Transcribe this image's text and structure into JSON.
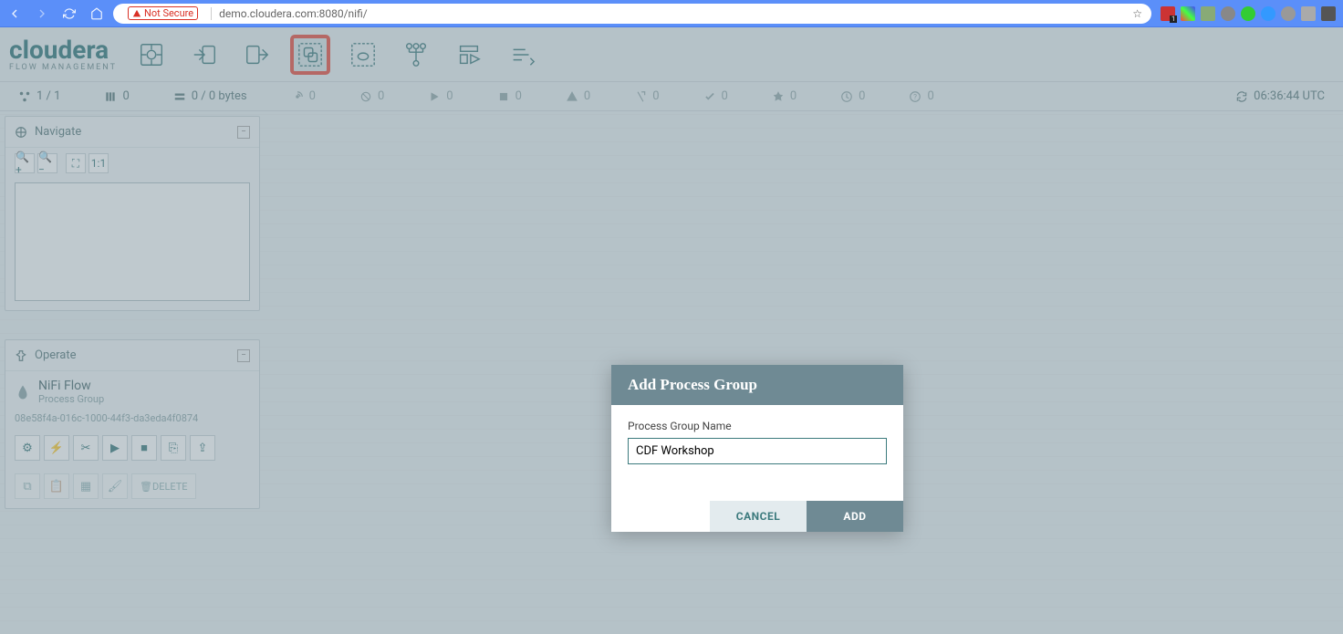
{
  "browser": {
    "not_secure": "Not Secure",
    "url": "demo.cloudera.com:8080/nifi/",
    "ext_badge": "1"
  },
  "logo": {
    "brand": "cloudera",
    "sub": "FLOW MANAGEMENT"
  },
  "toolbar": {
    "items": [
      {
        "name": "processor"
      },
      {
        "name": "input-port"
      },
      {
        "name": "output-port"
      },
      {
        "name": "process-group",
        "highlight": true
      },
      {
        "name": "remote-process-group"
      },
      {
        "name": "funnel"
      },
      {
        "name": "template"
      },
      {
        "name": "label"
      }
    ]
  },
  "status": {
    "nodes": "1 / 1",
    "threads": "0",
    "queued": "0 / 0 bytes",
    "transmitting": "0",
    "not_transmitting": "0",
    "running": "0",
    "stopped": "0",
    "invalid": "0",
    "disabled": "0",
    "uptodate": "0",
    "locally_modified": "0",
    "stale": "0",
    "sync_failure": "0",
    "timestamp": "06:36:44 UTC"
  },
  "navigate": {
    "title": "Navigate"
  },
  "operate": {
    "title": "Operate",
    "flow_name": "NiFi Flow",
    "flow_type": "Process Group",
    "flow_id": "08e58f4a-016c-1000-44f3-da3eda4f0874",
    "delete_label": "DELETE"
  },
  "dialog": {
    "title": "Add Process Group",
    "field_label": "Process Group Name",
    "field_value": "CDF Workshop",
    "cancel": "CANCEL",
    "add": "ADD"
  }
}
